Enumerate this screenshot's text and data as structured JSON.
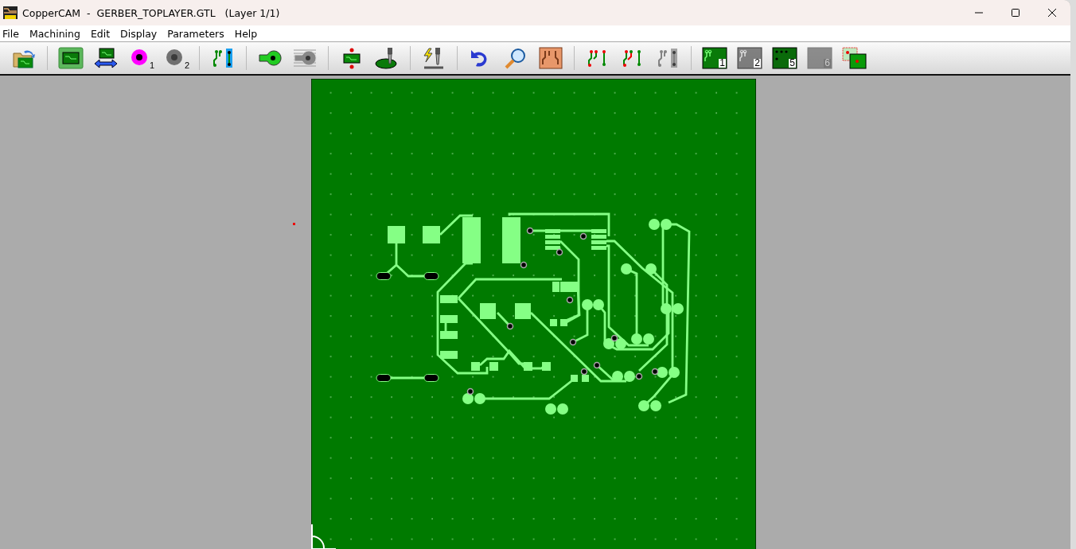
{
  "window": {
    "title": "CopperCAM  -  GERBER_TOPLAYER.GTL   (Layer 1/1)"
  },
  "menu": [
    {
      "label": "File"
    },
    {
      "label": "Machining"
    },
    {
      "label": "Edit"
    },
    {
      "label": "Display"
    },
    {
      "label": "Parameters"
    },
    {
      "label": "Help"
    }
  ],
  "toolbar": [
    [
      {
        "kind": "open",
        "disabled": false
      }
    ],
    [
      {
        "kind": "board",
        "disabled": false
      },
      {
        "kind": "flip",
        "disabled": false
      },
      {
        "kind": "pad",
        "number": "1",
        "disabled": false
      },
      {
        "kind": "pad",
        "number": "2",
        "disabled": true
      }
    ],
    [
      {
        "kind": "tracks",
        "disabled": false
      }
    ],
    [
      {
        "kind": "pad-outline",
        "disabled": false
      },
      {
        "kind": "hatch",
        "disabled": false
      }
    ],
    [
      {
        "kind": "origin",
        "disabled": false
      },
      {
        "kind": "mill",
        "disabled": false
      }
    ],
    [
      {
        "kind": "engrave",
        "disabled": false
      }
    ],
    [
      {
        "kind": "undo",
        "disabled": false
      },
      {
        "kind": "zoom",
        "disabled": false
      },
      {
        "kind": "copper",
        "disabled": false
      }
    ],
    [
      {
        "kind": "tracks-red",
        "disabled": false
      },
      {
        "kind": "tracks-cut",
        "disabled": false
      },
      {
        "kind": "tracks",
        "disabled": true
      }
    ],
    [
      {
        "kind": "layer",
        "number": "1",
        "disabled": false
      },
      {
        "kind": "layer",
        "number": "2",
        "disabled": true
      },
      {
        "kind": "drill",
        "number": "5",
        "disabled": false
      },
      {
        "kind": "blank",
        "number": "6",
        "disabled": true
      },
      {
        "kind": "panel",
        "disabled": false
      }
    ]
  ]
}
